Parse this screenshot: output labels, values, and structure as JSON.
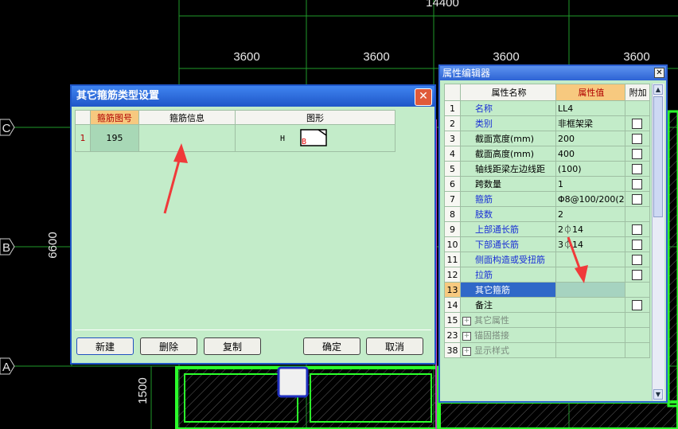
{
  "drawing": {
    "top_dim": "14400",
    "spans": [
      "3600",
      "3600",
      "3600",
      "3600"
    ],
    "axis_labels": [
      "C",
      "B",
      "A"
    ],
    "left_dim": "6600",
    "bottom_dim": "1500"
  },
  "stirrup_dialog": {
    "title": "其它箍筋类型设置",
    "close": "✕",
    "headers": [
      "箍筋图号",
      "箍筋信息",
      "图形"
    ],
    "rows": [
      {
        "index": "1",
        "code": "195",
        "info": "",
        "shape_h": "H",
        "shape_b": "B"
      }
    ],
    "buttons": {
      "new": "新建",
      "delete": "删除",
      "copy": "复制",
      "ok": "确定",
      "cancel": "取消"
    }
  },
  "property_editor": {
    "title": "属性编辑器",
    "close": "✕",
    "headers": {
      "name": "属性名称",
      "value": "属性值",
      "extra": "附加"
    },
    "rows": [
      {
        "num": "1",
        "name": "名称",
        "value": "LL4",
        "check": false,
        "style": "blue"
      },
      {
        "num": "2",
        "name": "类别",
        "value": "非框架梁",
        "check": true,
        "style": "blue"
      },
      {
        "num": "3",
        "name": "截面宽度(mm)",
        "value": "200",
        "check": true,
        "style": ""
      },
      {
        "num": "4",
        "name": "截面高度(mm)",
        "value": "400",
        "check": true,
        "style": ""
      },
      {
        "num": "5",
        "name": "轴线距梁左边线距",
        "value": "(100)",
        "check": true,
        "style": ""
      },
      {
        "num": "6",
        "name": "跨数量",
        "value": "1",
        "check": true,
        "style": ""
      },
      {
        "num": "7",
        "name": "箍筋",
        "value": "Φ8@100/200(2",
        "check": true,
        "style": "blue"
      },
      {
        "num": "8",
        "name": "肢数",
        "value": "2",
        "check": false,
        "style": "blue"
      },
      {
        "num": "9",
        "name": "上部通长筋",
        "value": "2⏀14",
        "check": true,
        "style": "blue"
      },
      {
        "num": "10",
        "name": "下部通长筋",
        "value": "3⏀14",
        "check": true,
        "style": "blue"
      },
      {
        "num": "11",
        "name": "侧面构造或受扭筋",
        "value": "",
        "check": true,
        "style": "blue"
      },
      {
        "num": "12",
        "name": "拉筋",
        "value": "",
        "check": true,
        "style": "blue"
      },
      {
        "num": "13",
        "name": "其它箍筋",
        "value": "",
        "check": false,
        "style": "sel"
      },
      {
        "num": "14",
        "name": "备注",
        "value": "",
        "check": true,
        "style": ""
      },
      {
        "num": "15",
        "name": "其它属性",
        "value": "",
        "check": false,
        "style": "gray",
        "expand": "+"
      },
      {
        "num": "23",
        "name": "锚固搭接",
        "value": "",
        "check": false,
        "style": "gray",
        "expand": "+"
      },
      {
        "num": "38",
        "name": "显示样式",
        "value": "",
        "check": false,
        "style": "gray",
        "expand": "+"
      }
    ]
  },
  "colors": {
    "grid": "#1f9a2a",
    "beam": "#2bff2b",
    "dialog_bg": "#c3ecc9",
    "title_blue": "#1f56c8",
    "annotation_arrow": "#f03a3a"
  }
}
